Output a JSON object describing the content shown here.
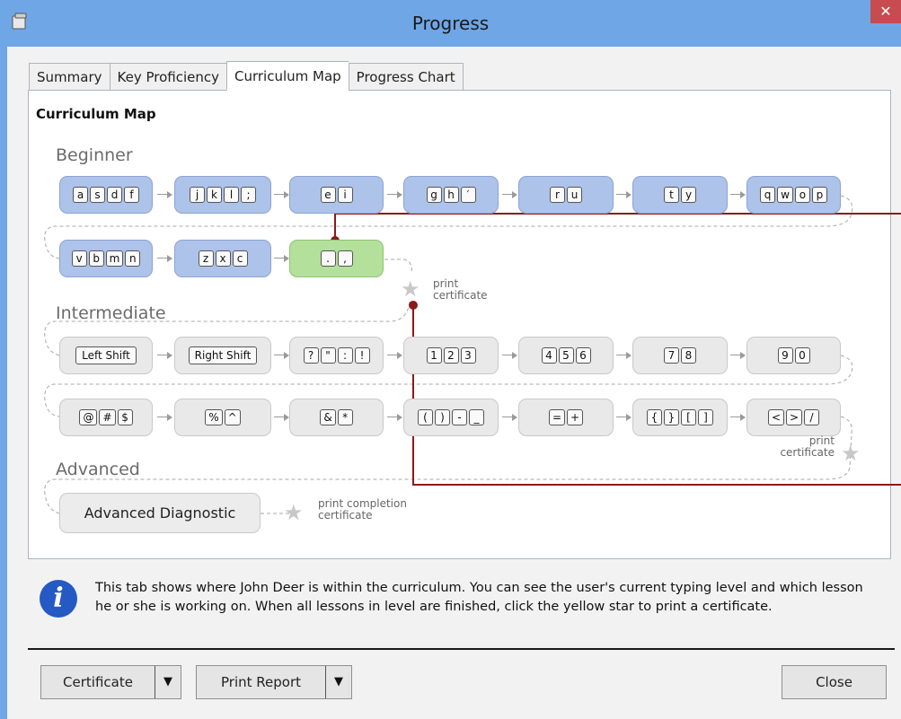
{
  "window": {
    "title": "Progress",
    "close_glyph": "✕"
  },
  "tabs": [
    {
      "label": "Summary"
    },
    {
      "label": "Key Proficiency"
    },
    {
      "label": "Curriculum Map"
    },
    {
      "label": "Progress Chart"
    }
  ],
  "active_tab": "Curriculum Map",
  "panel": {
    "title": "Curriculum Map"
  },
  "levels": {
    "beginner": "Beginner",
    "intermediate": "Intermediate",
    "advanced": "Advanced"
  },
  "beginner_lessons": [
    {
      "keys": [
        "a",
        "s",
        "d",
        "f"
      ]
    },
    {
      "keys": [
        "j",
        "k",
        "l",
        ";"
      ]
    },
    {
      "keys": [
        "e",
        "i"
      ]
    },
    {
      "keys": [
        "g",
        "h",
        "′"
      ]
    },
    {
      "keys": [
        "r",
        "u"
      ]
    },
    {
      "keys": [
        "t",
        "y"
      ]
    },
    {
      "keys": [
        "q",
        "w",
        "o",
        "p"
      ]
    },
    {
      "keys": [
        "v",
        "b",
        "m",
        "n"
      ]
    },
    {
      "keys": [
        "z",
        "x",
        "c"
      ]
    },
    {
      "keys": [
        ".",
        ","
      ],
      "current": true
    }
  ],
  "intermediate_lessons": [
    {
      "keys": [
        "Left Shift"
      ]
    },
    {
      "keys": [
        "Right Shift"
      ]
    },
    {
      "keys": [
        "?",
        "\"",
        ":",
        "!"
      ]
    },
    {
      "keys": [
        "1",
        "2",
        "3"
      ]
    },
    {
      "keys": [
        "4",
        "5",
        "6"
      ]
    },
    {
      "keys": [
        "7",
        "8"
      ]
    },
    {
      "keys": [
        "9",
        "0"
      ]
    },
    {
      "keys": [
        "@",
        "#",
        "$"
      ]
    },
    {
      "keys": [
        "%",
        "^"
      ]
    },
    {
      "keys": [
        "&",
        "*"
      ]
    },
    {
      "keys": [
        "(",
        ")",
        "-",
        "_"
      ]
    },
    {
      "keys": [
        "=",
        "+"
      ]
    },
    {
      "keys": [
        "{",
        "}",
        "[",
        "]"
      ]
    },
    {
      "keys": [
        "<",
        ">",
        "/"
      ]
    }
  ],
  "advanced_lesson": "Advanced Diagnostic",
  "certificates": {
    "beginner_line1": "print",
    "beginner_line2": "certificate",
    "intermediate_line1": "print",
    "intermediate_line2": "certificate",
    "advanced_line1": "print completion",
    "advanced_line2": "certificate"
  },
  "info": {
    "text": "This tab shows where John Deer is within the curriculum. You can see the user's current typing level and which lesson he or she is working on. When all lessons in level are finished, click the yellow star to print a certificate."
  },
  "buttons": {
    "certificate": "Certificate",
    "print_report": "Print Report",
    "dropdown_glyph": "▼",
    "close": "Close"
  },
  "icons": [
    "app-icon",
    "close-icon",
    "star-icon",
    "info-icon",
    "dropdown-arrow-icon"
  ],
  "colors": {
    "titlebar": "#6fa6e6",
    "beginner_lesson": "#aec3ea",
    "current_lesson": "#b3e09a",
    "intermediate_lesson": "#e9e9e9",
    "callout_line": "#8b1a1a",
    "info_icon": "#2559c4"
  }
}
